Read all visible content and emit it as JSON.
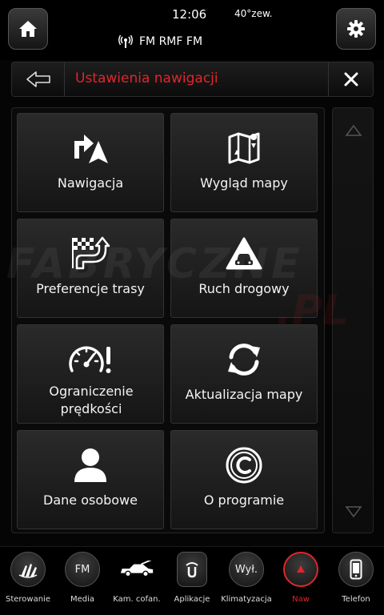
{
  "status": {
    "time": "12:06",
    "temperature": "40°zew.",
    "radio": "FM RMF FM"
  },
  "header": {
    "title": "Ustawienia nawigacji"
  },
  "tiles": [
    {
      "label": "Nawigacja",
      "icon": "turn-arrow-nav-icon"
    },
    {
      "label": "Wygląd mapy",
      "icon": "map-icon"
    },
    {
      "label": "Preferencje trasy",
      "icon": "checkered-flag-route-icon"
    },
    {
      "label": "Ruch drogowy",
      "icon": "traffic-warning-icon"
    },
    {
      "label": "Ograniczenie prędkości",
      "icon": "speedometer-warning-icon"
    },
    {
      "label": "Aktualizacja mapy",
      "icon": "refresh-icon"
    },
    {
      "label": "Dane osobowe",
      "icon": "person-icon"
    },
    {
      "label": "O programie",
      "icon": "copyright-icon"
    }
  ],
  "watermark": {
    "line1": "FABRYCZNE",
    "line2": ".PL"
  },
  "dock": [
    {
      "label": "Sterowanie",
      "icon": "steering-controls-icon",
      "active": false
    },
    {
      "label": "Media",
      "icon": "media-fm-icon",
      "text": "FM",
      "active": false
    },
    {
      "label": "Kam. cofan.",
      "icon": "rear-camera-car-icon",
      "active": false
    },
    {
      "label": "Aplikacje",
      "icon": "apps-icon",
      "active": false
    },
    {
      "label": "Klimatyzacja",
      "icon": "climate-icon",
      "text": "Wył.",
      "active": false
    },
    {
      "label": "Naw",
      "icon": "navigation-icon",
      "active": true
    },
    {
      "label": "Telefon",
      "icon": "phone-icon",
      "active": false
    }
  ],
  "colors": {
    "accent_red": "#e0262b",
    "background": "#050505",
    "tile": "#222222"
  }
}
